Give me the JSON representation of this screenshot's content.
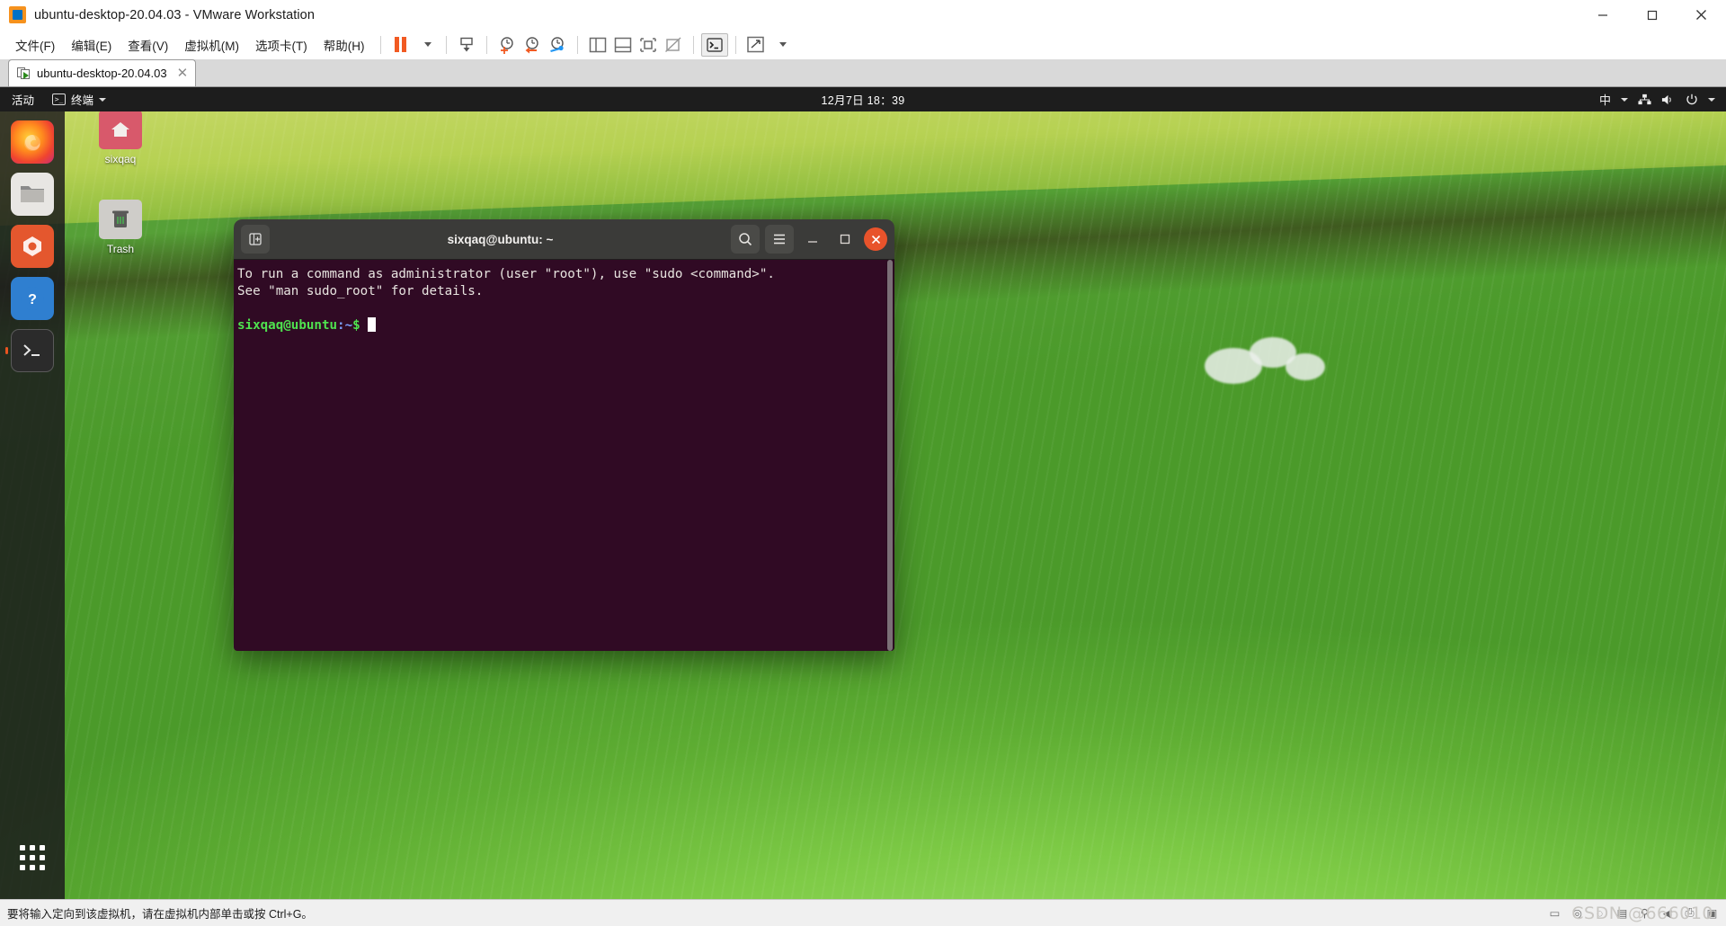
{
  "window": {
    "title": "ubuntu-desktop-20.04.03 - VMware Workstation",
    "logo_icon": "vmware-logo-icon",
    "minimize_icon": "minimize-icon",
    "maximize_icon": "maximize-icon",
    "close_icon": "close-icon"
  },
  "menubar": {
    "items": [
      {
        "label": "文件(F)",
        "name": "menu-file"
      },
      {
        "label": "编辑(E)",
        "name": "menu-edit"
      },
      {
        "label": "查看(V)",
        "name": "menu-view"
      },
      {
        "label": "虚拟机(M)",
        "name": "menu-vm"
      },
      {
        "label": "选项卡(T)",
        "name": "menu-tabs"
      },
      {
        "label": "帮助(H)",
        "name": "menu-help"
      }
    ]
  },
  "toolbar": {
    "buttons": [
      {
        "name": "suspend-button",
        "icon": "pause-icon"
      },
      {
        "name": "suspend-dropdown",
        "icon": "chevron-down-icon"
      },
      {
        "name": "power-on-button",
        "icon": "power-guest-icon"
      },
      {
        "name": "take-snapshot-button",
        "icon": "snapshot-add-icon"
      },
      {
        "name": "revert-snapshot-button",
        "icon": "snapshot-revert-icon"
      },
      {
        "name": "snapshot-manager-button",
        "icon": "snapshot-manage-icon"
      },
      {
        "name": "show-library-button",
        "icon": "panel-left-icon"
      },
      {
        "name": "show-thumbnail-bar-button",
        "icon": "panel-bottom-icon"
      },
      {
        "name": "show-console-view-button",
        "icon": "console-view-icon"
      },
      {
        "name": "hide-console-view-button",
        "icon": "console-view-off-icon"
      },
      {
        "name": "send-ctrl-alt-del-button",
        "icon": "terminal-icon"
      },
      {
        "name": "enter-fullscreen-button",
        "icon": "fullscreen-expand-icon"
      },
      {
        "name": "fullscreen-dropdown",
        "icon": "chevron-down-icon"
      }
    ]
  },
  "tabs": [
    {
      "label": "ubuntu-desktop-20.04.03",
      "icon": "vm-running-icon",
      "close_icon": "close-icon",
      "active": true
    }
  ],
  "guest": {
    "panel": {
      "activities": "活动",
      "app_menu": "终端",
      "app_menu_icon": "terminal-icon",
      "app_menu_caret": "chevron-down-icon",
      "clock": "12月7日 18：39",
      "indicators": [
        {
          "name": "input-method-indicator",
          "label": "中",
          "icon": "ime-icon"
        },
        {
          "name": "ime-caret",
          "label": "",
          "icon": "chevron-down-icon"
        },
        {
          "name": "network-indicator",
          "label": "",
          "icon": "network-icon"
        },
        {
          "name": "volume-indicator",
          "label": "",
          "icon": "volume-icon"
        },
        {
          "name": "power-indicator",
          "label": "",
          "icon": "power-icon"
        },
        {
          "name": "system-menu-caret",
          "label": "",
          "icon": "chevron-down-icon"
        }
      ]
    },
    "dock": [
      {
        "name": "dock-item-firefox",
        "icon": "firefox-icon",
        "running": false
      },
      {
        "name": "dock-item-files",
        "icon": "files-icon",
        "running": false
      },
      {
        "name": "dock-item-software",
        "icon": "ubuntu-software-icon",
        "running": false
      },
      {
        "name": "dock-item-help",
        "icon": "help-icon",
        "running": false
      },
      {
        "name": "dock-item-terminal",
        "icon": "terminal-icon",
        "running": true
      }
    ],
    "dock_apps_button": {
      "name": "show-applications-button",
      "icon": "grid-apps-icon"
    },
    "desktop_icons": [
      {
        "label": "sixqaq",
        "name": "desktop-icon-home",
        "icon": "home-folder-icon"
      },
      {
        "label": "Trash",
        "name": "desktop-icon-trash",
        "icon": "trash-icon"
      }
    ]
  },
  "terminal": {
    "title": "sixqaq@ubuntu: ~",
    "new_tab_icon": "new-tab-icon",
    "search_icon": "search-icon",
    "menu_icon": "hamburger-menu-icon",
    "minimize_icon": "minimize-icon",
    "maximize_icon": "maximize-icon",
    "close_icon": "close-icon",
    "lines": [
      "To run a command as administrator (user \"root\"), use \"sudo <command>\".",
      "See \"man sudo_root\" for details."
    ],
    "prompt_user": "sixqaq@ubuntu",
    "prompt_path": ":~",
    "prompt_symbol": "$"
  },
  "statusbar": {
    "message": "要将输入定向到该虚拟机，请在虚拟机内部单击或按 Ctrl+G。",
    "icons": [
      {
        "name": "status-harddisk-icon",
        "glyph": "▭"
      },
      {
        "name": "status-cd-icon",
        "glyph": "◎"
      },
      {
        "name": "status-floppy-icon",
        "glyph": "◌"
      },
      {
        "name": "status-network-icon",
        "glyph": "▤"
      },
      {
        "name": "status-usb-icon",
        "glyph": "⚲"
      },
      {
        "name": "status-sound-icon",
        "glyph": "◀"
      },
      {
        "name": "status-printer-icon",
        "glyph": "⎙"
      },
      {
        "name": "status-display-icon",
        "glyph": "▣"
      }
    ]
  },
  "watermark": "CSDN @666010"
}
